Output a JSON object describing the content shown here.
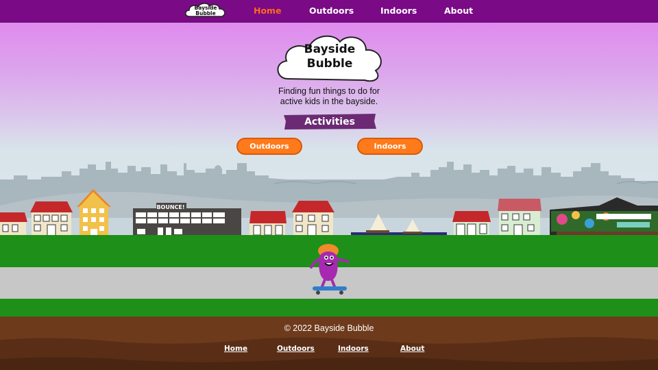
{
  "nav": {
    "logo_line1": "Bayside",
    "logo_line2": "Bubble",
    "links": [
      {
        "label": "Home",
        "active": true
      },
      {
        "label": "Outdoors",
        "active": false
      },
      {
        "label": "Indoors",
        "active": false
      },
      {
        "label": "About",
        "active": false
      }
    ]
  },
  "hero": {
    "title_line1": "Bayside",
    "title_line2": "Bubble",
    "tagline_line1": "Finding fun things to do for",
    "tagline_line2": "active kids in the bayside.",
    "section_label": "Activities",
    "buttons": [
      {
        "label": "Outdoors"
      },
      {
        "label": "Indoors"
      }
    ]
  },
  "scene": {
    "bounce_sign": "BOUNCE!"
  },
  "footer": {
    "copyright": "© 2022 Bayside Bubble",
    "links": [
      {
        "label": "Home"
      },
      {
        "label": "Outdoors"
      },
      {
        "label": "Indoors"
      },
      {
        "label": "About"
      }
    ]
  },
  "colors": {
    "nav_bg": "#7a0a86",
    "accent_orange": "#ff7a1a",
    "banner_purple": "#6b2a73",
    "grass": "#1e8f18",
    "soil": "#6e3a1c"
  }
}
